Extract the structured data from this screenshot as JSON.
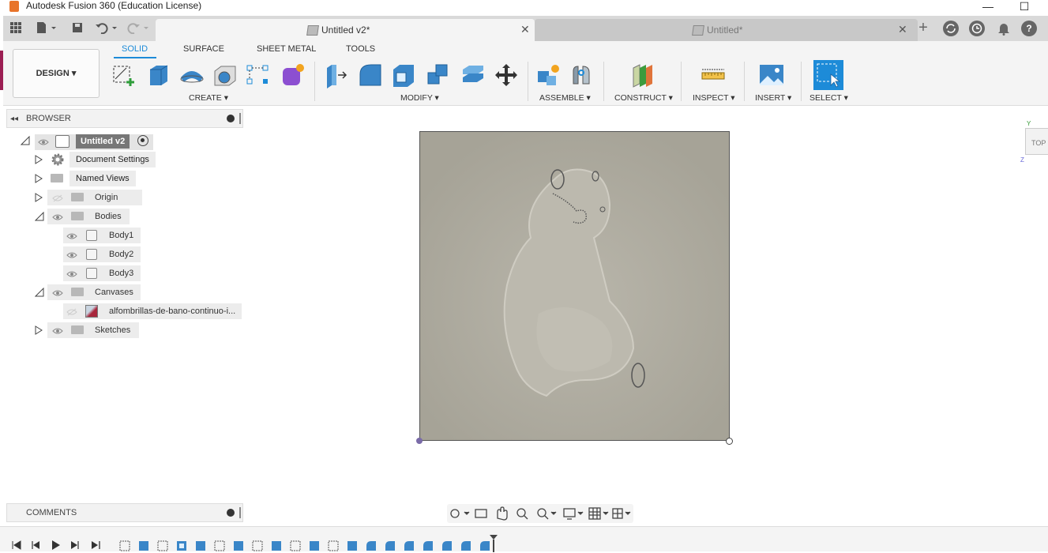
{
  "window": {
    "title": "Autodesk Fusion 360 (Education License)",
    "minimize": "—",
    "maximize": "☐"
  },
  "tabs": [
    {
      "label": "Untitled v2*",
      "close": "✕"
    },
    {
      "label": "Untitled*",
      "close": "✕"
    }
  ],
  "quick_access": {
    "new_tab": "+"
  },
  "toolbar": {
    "workspace": "DESIGN ▾",
    "tabs": [
      "SOLID",
      "SURFACE",
      "SHEET METAL",
      "TOOLS"
    ],
    "groups": [
      "CREATE ▾",
      "MODIFY ▾",
      "ASSEMBLE ▾",
      "CONSTRUCT ▾",
      "INSPECT ▾",
      "INSERT ▾",
      "SELECT ▾"
    ]
  },
  "browser": {
    "header": "BROWSER",
    "root": "Untitled v2",
    "items": [
      {
        "label": "Document Settings"
      },
      {
        "label": "Named Views"
      },
      {
        "label": "Origin"
      },
      {
        "label": "Bodies"
      },
      {
        "label": "Body1"
      },
      {
        "label": "Body2"
      },
      {
        "label": "Body3"
      },
      {
        "label": "Canvases"
      },
      {
        "label": "alfombrillas-de-bano-continuo-i..."
      },
      {
        "label": "Sketches"
      }
    ]
  },
  "viewcube": {
    "label": "TOP"
  },
  "comments": {
    "header": "COMMENTS"
  },
  "colors": {
    "accent": "#1d8bd8",
    "brand_edge": "#9b1e52",
    "model_surface": "#aca99d"
  }
}
